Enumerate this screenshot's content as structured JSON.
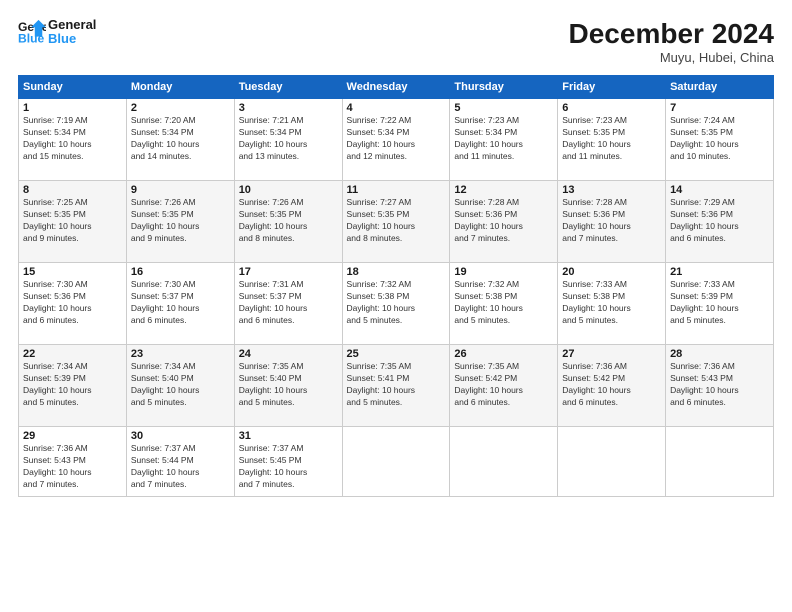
{
  "app": {
    "name1": "General",
    "name2": "Blue"
  },
  "header": {
    "month": "December 2024",
    "location": "Muyu, Hubei, China"
  },
  "weekdays": [
    "Sunday",
    "Monday",
    "Tuesday",
    "Wednesday",
    "Thursday",
    "Friday",
    "Saturday"
  ],
  "weeks": [
    [
      {
        "day": "1",
        "sunrise": "7:19 AM",
        "sunset": "5:34 PM",
        "daylight": "10 hours and 15 minutes."
      },
      {
        "day": "2",
        "sunrise": "7:20 AM",
        "sunset": "5:34 PM",
        "daylight": "10 hours and 14 minutes."
      },
      {
        "day": "3",
        "sunrise": "7:21 AM",
        "sunset": "5:34 PM",
        "daylight": "10 hours and 13 minutes."
      },
      {
        "day": "4",
        "sunrise": "7:22 AM",
        "sunset": "5:34 PM",
        "daylight": "10 hours and 12 minutes."
      },
      {
        "day": "5",
        "sunrise": "7:23 AM",
        "sunset": "5:34 PM",
        "daylight": "10 hours and 11 minutes."
      },
      {
        "day": "6",
        "sunrise": "7:23 AM",
        "sunset": "5:35 PM",
        "daylight": "10 hours and 11 minutes."
      },
      {
        "day": "7",
        "sunrise": "7:24 AM",
        "sunset": "5:35 PM",
        "daylight": "10 hours and 10 minutes."
      }
    ],
    [
      {
        "day": "8",
        "sunrise": "7:25 AM",
        "sunset": "5:35 PM",
        "daylight": "10 hours and 9 minutes."
      },
      {
        "day": "9",
        "sunrise": "7:26 AM",
        "sunset": "5:35 PM",
        "daylight": "10 hours and 9 minutes."
      },
      {
        "day": "10",
        "sunrise": "7:26 AM",
        "sunset": "5:35 PM",
        "daylight": "10 hours and 8 minutes."
      },
      {
        "day": "11",
        "sunrise": "7:27 AM",
        "sunset": "5:35 PM",
        "daylight": "10 hours and 8 minutes."
      },
      {
        "day": "12",
        "sunrise": "7:28 AM",
        "sunset": "5:36 PM",
        "daylight": "10 hours and 7 minutes."
      },
      {
        "day": "13",
        "sunrise": "7:28 AM",
        "sunset": "5:36 PM",
        "daylight": "10 hours and 7 minutes."
      },
      {
        "day": "14",
        "sunrise": "7:29 AM",
        "sunset": "5:36 PM",
        "daylight": "10 hours and 6 minutes."
      }
    ],
    [
      {
        "day": "15",
        "sunrise": "7:30 AM",
        "sunset": "5:36 PM",
        "daylight": "10 hours and 6 minutes."
      },
      {
        "day": "16",
        "sunrise": "7:30 AM",
        "sunset": "5:37 PM",
        "daylight": "10 hours and 6 minutes."
      },
      {
        "day": "17",
        "sunrise": "7:31 AM",
        "sunset": "5:37 PM",
        "daylight": "10 hours and 6 minutes."
      },
      {
        "day": "18",
        "sunrise": "7:32 AM",
        "sunset": "5:38 PM",
        "daylight": "10 hours and 5 minutes."
      },
      {
        "day": "19",
        "sunrise": "7:32 AM",
        "sunset": "5:38 PM",
        "daylight": "10 hours and 5 minutes."
      },
      {
        "day": "20",
        "sunrise": "7:33 AM",
        "sunset": "5:38 PM",
        "daylight": "10 hours and 5 minutes."
      },
      {
        "day": "21",
        "sunrise": "7:33 AM",
        "sunset": "5:39 PM",
        "daylight": "10 hours and 5 minutes."
      }
    ],
    [
      {
        "day": "22",
        "sunrise": "7:34 AM",
        "sunset": "5:39 PM",
        "daylight": "10 hours and 5 minutes."
      },
      {
        "day": "23",
        "sunrise": "7:34 AM",
        "sunset": "5:40 PM",
        "daylight": "10 hours and 5 minutes."
      },
      {
        "day": "24",
        "sunrise": "7:35 AM",
        "sunset": "5:40 PM",
        "daylight": "10 hours and 5 minutes."
      },
      {
        "day": "25",
        "sunrise": "7:35 AM",
        "sunset": "5:41 PM",
        "daylight": "10 hours and 5 minutes."
      },
      {
        "day": "26",
        "sunrise": "7:35 AM",
        "sunset": "5:42 PM",
        "daylight": "10 hours and 6 minutes."
      },
      {
        "day": "27",
        "sunrise": "7:36 AM",
        "sunset": "5:42 PM",
        "daylight": "10 hours and 6 minutes."
      },
      {
        "day": "28",
        "sunrise": "7:36 AM",
        "sunset": "5:43 PM",
        "daylight": "10 hours and 6 minutes."
      }
    ],
    [
      {
        "day": "29",
        "sunrise": "7:36 AM",
        "sunset": "5:43 PM",
        "daylight": "10 hours and 7 minutes."
      },
      {
        "day": "30",
        "sunrise": "7:37 AM",
        "sunset": "5:44 PM",
        "daylight": "10 hours and 7 minutes."
      },
      {
        "day": "31",
        "sunrise": "7:37 AM",
        "sunset": "5:45 PM",
        "daylight": "10 hours and 7 minutes."
      },
      null,
      null,
      null,
      null
    ]
  ],
  "labels": {
    "sunrise": "Sunrise:",
    "sunset": "Sunset:",
    "daylight": "Daylight:"
  }
}
